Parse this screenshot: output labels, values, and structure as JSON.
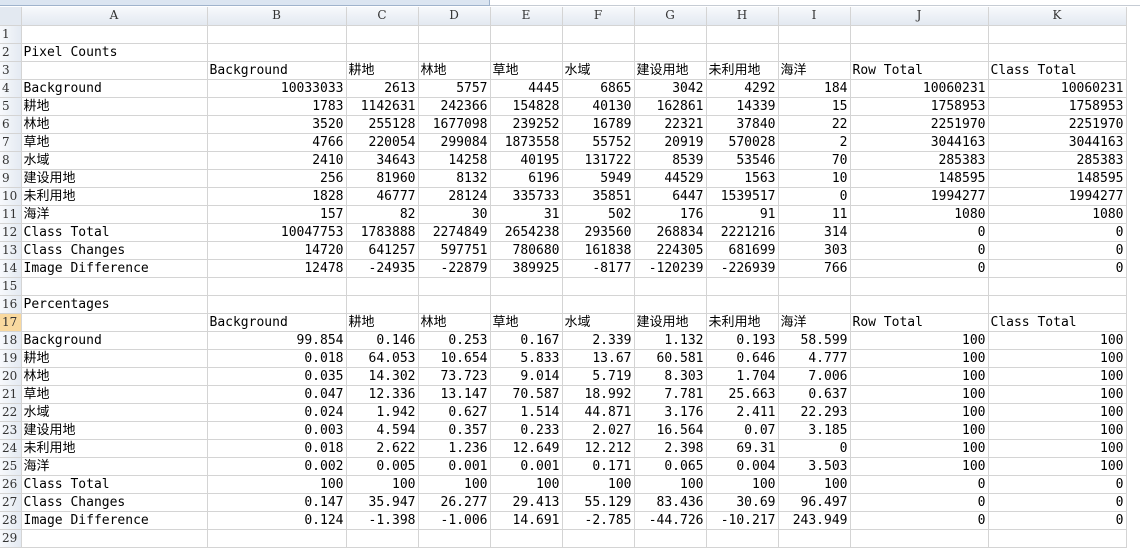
{
  "columns": [
    "A",
    "B",
    "C",
    "D",
    "E",
    "F",
    "G",
    "H",
    "I",
    "J",
    "K"
  ],
  "row_numbers": [
    "1",
    "2",
    "3",
    "4",
    "5",
    "6",
    "7",
    "8",
    "9",
    "10",
    "11",
    "12",
    "13",
    "14",
    "15",
    "16",
    "17",
    "18",
    "19",
    "20",
    "21",
    "22",
    "23",
    "24",
    "25",
    "26",
    "27",
    "28",
    "29"
  ],
  "selected_row": "17",
  "rows": [
    [],
    [
      "Pixel Counts"
    ],
    [
      "",
      "Background",
      "耕地",
      "林地",
      "草地",
      "水域",
      "建设用地",
      "未利用地",
      "海洋",
      "Row Total",
      "Class Total"
    ],
    [
      "Background",
      "10033033",
      "2613",
      "5757",
      "4445",
      "6865",
      "3042",
      "4292",
      "184",
      "10060231",
      "10060231"
    ],
    [
      "耕地",
      "1783",
      "1142631",
      "242366",
      "154828",
      "40130",
      "162861",
      "14339",
      "15",
      "1758953",
      "1758953"
    ],
    [
      "林地",
      "3520",
      "255128",
      "1677098",
      "239252",
      "16789",
      "22321",
      "37840",
      "22",
      "2251970",
      "2251970"
    ],
    [
      "草地",
      "4766",
      "220054",
      "299084",
      "1873558",
      "55752",
      "20919",
      "570028",
      "2",
      "3044163",
      "3044163"
    ],
    [
      "水域",
      "2410",
      "34643",
      "14258",
      "40195",
      "131722",
      "8539",
      "53546",
      "70",
      "285383",
      "285383"
    ],
    [
      "建设用地",
      "256",
      "81960",
      "8132",
      "6196",
      "5949",
      "44529",
      "1563",
      "10",
      "148595",
      "148595"
    ],
    [
      "未利用地",
      "1828",
      "46777",
      "28124",
      "335733",
      "35851",
      "6447",
      "1539517",
      "0",
      "1994277",
      "1994277"
    ],
    [
      "海洋",
      "157",
      "82",
      "30",
      "31",
      "502",
      "176",
      "91",
      "11",
      "1080",
      "1080"
    ],
    [
      "Class Total",
      "10047753",
      "1783888",
      "2274849",
      "2654238",
      "293560",
      "268834",
      "2221216",
      "314",
      "0",
      "0"
    ],
    [
      "Class Changes",
      "14720",
      "641257",
      "597751",
      "780680",
      "161838",
      "224305",
      "681699",
      "303",
      "0",
      "0"
    ],
    [
      "Image Difference",
      "12478",
      "-24935",
      "-22879",
      "389925",
      "-8177",
      "-120239",
      "-226939",
      "766",
      "0",
      "0"
    ],
    [],
    [
      "Percentages"
    ],
    [
      "",
      "Background",
      "耕地",
      "林地",
      "草地",
      "水域",
      "建设用地",
      "未利用地",
      "海洋",
      "Row Total",
      "Class Total"
    ],
    [
      "Background",
      "99.854",
      "0.146",
      "0.253",
      "0.167",
      "2.339",
      "1.132",
      "0.193",
      "58.599",
      "100",
      "100"
    ],
    [
      "耕地",
      "0.018",
      "64.053",
      "10.654",
      "5.833",
      "13.67",
      "60.581",
      "0.646",
      "4.777",
      "100",
      "100"
    ],
    [
      "林地",
      "0.035",
      "14.302",
      "73.723",
      "9.014",
      "5.719",
      "8.303",
      "1.704",
      "7.006",
      "100",
      "100"
    ],
    [
      "草地",
      "0.047",
      "12.336",
      "13.147",
      "70.587",
      "18.992",
      "7.781",
      "25.663",
      "0.637",
      "100",
      "100"
    ],
    [
      "水域",
      "0.024",
      "1.942",
      "0.627",
      "1.514",
      "44.871",
      "3.176",
      "2.411",
      "22.293",
      "100",
      "100"
    ],
    [
      "建设用地",
      "0.003",
      "4.594",
      "0.357",
      "0.233",
      "2.027",
      "16.564",
      "0.07",
      "3.185",
      "100",
      "100"
    ],
    [
      "未利用地",
      "0.018",
      "2.622",
      "1.236",
      "12.649",
      "12.212",
      "2.398",
      "69.31",
      "0",
      "100",
      "100"
    ],
    [
      "海洋",
      "0.002",
      "0.005",
      "0.001",
      "0.001",
      "0.171",
      "0.065",
      "0.004",
      "3.503",
      "100",
      "100"
    ],
    [
      "Class Total",
      "100",
      "100",
      "100",
      "100",
      "100",
      "100",
      "100",
      "100",
      "0",
      "0"
    ],
    [
      "Class Changes",
      "0.147",
      "35.947",
      "26.277",
      "29.413",
      "55.129",
      "83.436",
      "30.69",
      "96.497",
      "0",
      "0"
    ],
    [
      "Image Difference",
      "0.124",
      "-1.398",
      "-1.006",
      "14.691",
      "-2.785",
      "-44.726",
      "-10.217",
      "243.949",
      "0",
      "0"
    ],
    []
  ]
}
